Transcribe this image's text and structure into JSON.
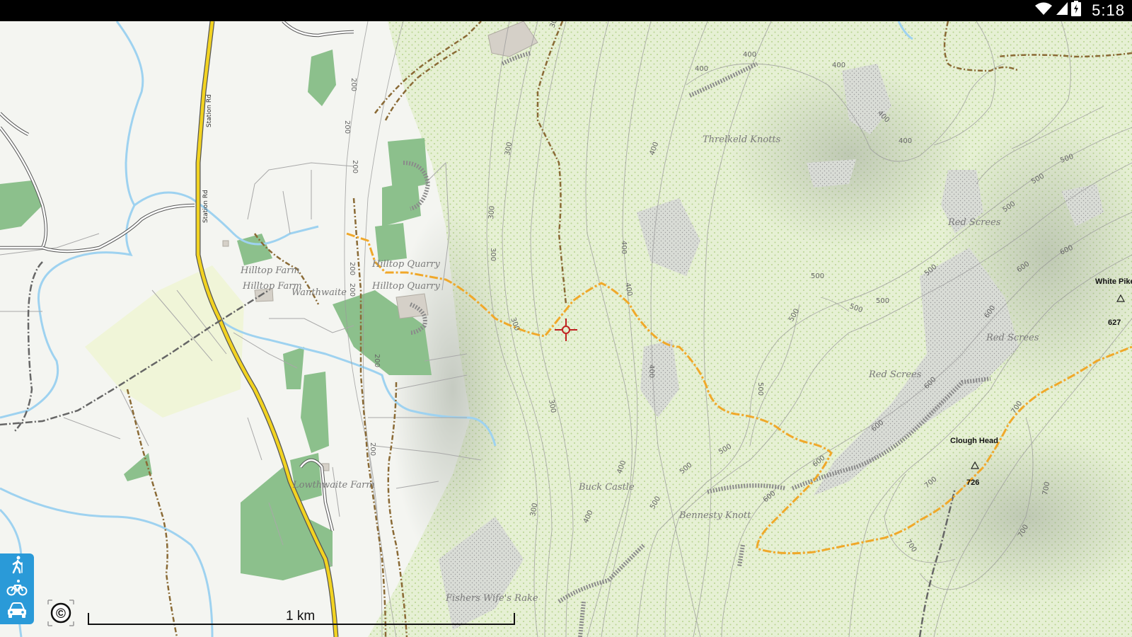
{
  "status_bar": {
    "time": "5:18",
    "icons": [
      "wifi-icon",
      "cell-signal-icon",
      "battery-charging-icon"
    ]
  },
  "map": {
    "places": [
      {
        "name": "Threlkeld Knotts"
      },
      {
        "name": "Red Screes"
      },
      {
        "name": "Red Screes"
      },
      {
        "name": "Red Screes"
      },
      {
        "name": "Hilltop Quarry"
      },
      {
        "name": "Hilltop Quarry"
      },
      {
        "name": "Hilltop Farm"
      },
      {
        "name": "Hilltop Farm"
      },
      {
        "name": "Wanthwaite"
      },
      {
        "name": "Buck Castle"
      },
      {
        "name": "Bennesty Knott"
      },
      {
        "name": "Lowthwaite Farm"
      },
      {
        "name": "Fishers Wife's Rake"
      }
    ],
    "roads": [
      "Station Rd",
      "Station Rd"
    ],
    "peaks": [
      {
        "name": "White Pike",
        "elevation": "627"
      },
      {
        "name": "Clough Head",
        "elevation": "726"
      }
    ],
    "contour_labels": [
      "200",
      "200",
      "200",
      "200",
      "200",
      "200",
      "200",
      "300",
      "300",
      "300",
      "300",
      "300",
      "300",
      "300",
      "400",
      "400",
      "400",
      "400",
      "400",
      "400",
      "400",
      "400",
      "400",
      "400",
      "400",
      "500",
      "500",
      "500",
      "500",
      "500",
      "500",
      "500",
      "500",
      "500",
      "500",
      "500",
      "500",
      "600",
      "600",
      "600",
      "600",
      "600",
      "600",
      "600",
      "700",
      "700",
      "700",
      "700",
      "700"
    ],
    "scale": {
      "label": "1 km"
    },
    "copyright_symbol": "©"
  },
  "travel_modes": [
    {
      "name": "hiking",
      "icon": "hiker-icon"
    },
    {
      "name": "cycling",
      "icon": "bicycle-icon"
    },
    {
      "name": "driving",
      "icon": "car-icon"
    }
  ],
  "colors": {
    "route": "#f0a82a",
    "path": "#8a6a35",
    "main_road": "#f2d321",
    "water": "#9ed2f0",
    "woodland": "#8cc08c",
    "open_land": "#e3eed0",
    "mode_panel": "#2a9ad8",
    "crosshair": "#c02020"
  }
}
